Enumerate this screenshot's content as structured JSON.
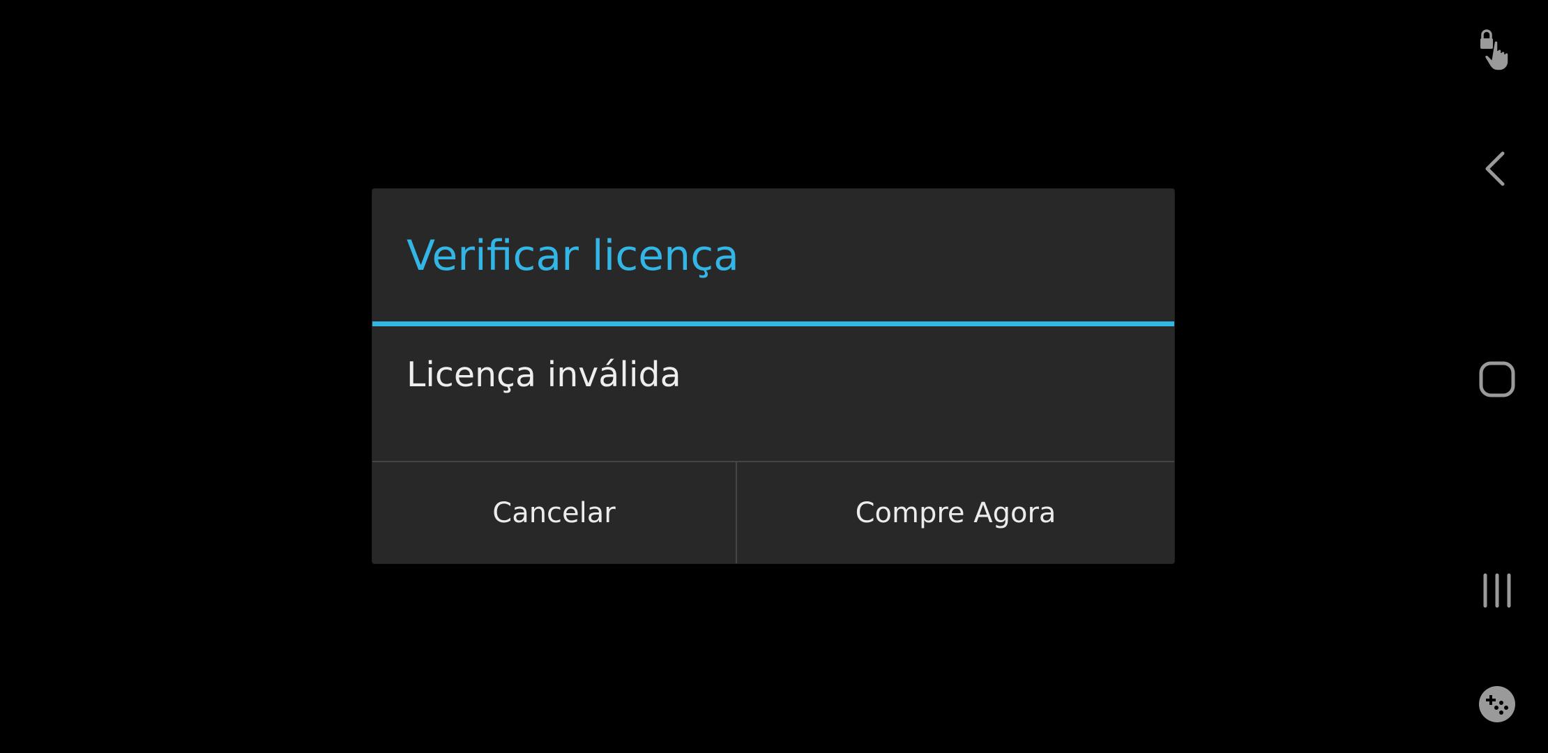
{
  "dialog": {
    "title": "Verificar licença",
    "message": "Licença inválida",
    "buttons": {
      "cancel": "Cancelar",
      "buy": "Compre Agora"
    }
  },
  "navbar": {
    "icons": [
      "touch-lock-icon",
      "back-icon",
      "home-icon",
      "recents-icon",
      "game-tools-icon"
    ]
  },
  "colors": {
    "accent": "#33b5e5",
    "dialog_bg": "#282828",
    "screen_bg": "#000000",
    "nav_icon": "#9a9a9a"
  }
}
